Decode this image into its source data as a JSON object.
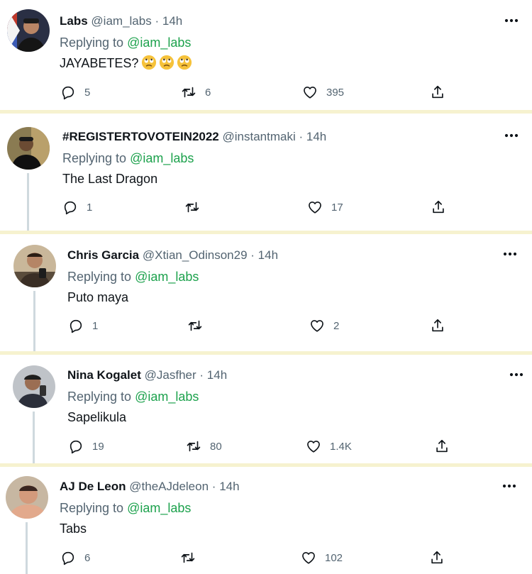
{
  "tweets": [
    {
      "name": "Labs",
      "handle": "@iam_labs",
      "dot": "·",
      "time": "14h",
      "reply_prefix": "Replying to",
      "reply_to": "@iam_labs",
      "text": "JAYABETES?",
      "emojis": [
        "rolling-eyes",
        "rolling-eyes",
        "rolling-eyes"
      ],
      "replies": "5",
      "retweets": "6",
      "likes": "395"
    },
    {
      "name": "#REGISTERTOVOTEIN2022",
      "handle": "@instantmaki",
      "dot": "·",
      "time": "14h",
      "reply_prefix": "Replying to",
      "reply_to": "@iam_labs",
      "text": "The Last Dragon",
      "replies": "1",
      "retweets": "",
      "likes": "17"
    },
    {
      "name": "Chris Garcia",
      "handle": "@Xtian_Odinson29",
      "dot": "·",
      "time": "14h",
      "reply_prefix": "Replying to",
      "reply_to": "@iam_labs",
      "text": "Puto maya",
      "replies": "1",
      "retweets": "",
      "likes": "2"
    },
    {
      "name": "Nina Kogalet",
      "handle": "@Jasfher",
      "dot": "·",
      "time": "14h",
      "reply_prefix": "Replying to",
      "reply_to": "@iam_labs",
      "text": "Sapelikula",
      "replies": "19",
      "retweets": "80",
      "likes": "1.4K"
    },
    {
      "name": "AJ De Leon",
      "handle": "@theAJdeleon",
      "dot": "·",
      "time": "14h",
      "reply_prefix": "Replying to",
      "reply_to": "@iam_labs",
      "text": "Tabs",
      "replies": "6",
      "retweets": "",
      "likes": "102"
    }
  ],
  "colors": {
    "mention": "#1da24d",
    "muted": "#536471",
    "text": "#0f1419",
    "separator": "#f6f2cf",
    "thread_line": "#cfd9de"
  }
}
